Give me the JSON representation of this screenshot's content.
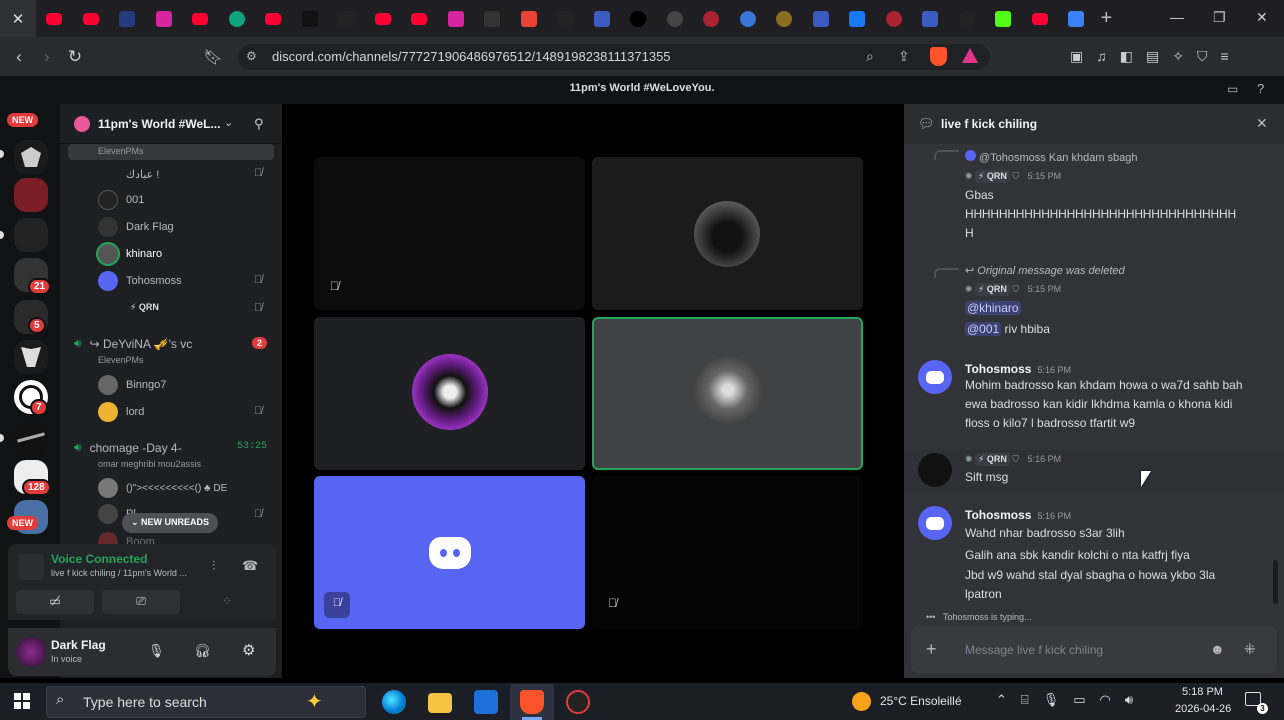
{
  "browser": {
    "tabs": [
      "youtube",
      "youtube",
      "paypal",
      "instagram",
      "youtube",
      "chatgpt",
      "youtube",
      "wattpad",
      "play",
      "youtube",
      "youtube",
      "instagram",
      "chrome-app",
      "gmail",
      "genius",
      "app",
      "x",
      "help",
      "shield",
      "globe",
      "bitcoin",
      "app",
      "facebook",
      "shield",
      "app",
      "openai",
      "kick",
      "youtube",
      "vpn"
    ],
    "url": "discord.com/channels/777271906486976512/1489198238111371355",
    "new_tab_icon": "plus"
  },
  "discord": {
    "server_title": "11pm's World #WeLoveYou.",
    "server_name": "11pm's World #WeL...",
    "rail": {
      "new_label": "NEW",
      "badges": [
        "21",
        "5",
        "7",
        "128"
      ],
      "new_label_bottom": "NEW"
    },
    "sidebar": {
      "partial_label": "ElevenPMs",
      "members_top": [
        {
          "name": "عبادك !",
          "color": "#b5bac1"
        },
        {
          "name": "001",
          "color": "#b5bac1"
        },
        {
          "name": "Dark Flag",
          "color": "#b5bac1"
        },
        {
          "name": "khinaro",
          "color": "#ffffff"
        },
        {
          "name": "Tohosmoss",
          "color": "#b5bac1"
        }
      ],
      "qrn_tag": "QRN",
      "vc2": {
        "name": "↪ DeYviNA 🎺's vc",
        "sub": "ElevenPMs",
        "badge": "2"
      },
      "members_vc2": [
        "Binngo7",
        "lord"
      ],
      "vc3": {
        "name": "chomage -Day 4-",
        "sub": "omar meghribi mou2assis",
        "timer": "53:25"
      },
      "members_vc3": [
        "()\"><<<<<<<<<() ♣ DE",
        "Pl..."
      ],
      "new_unreads": "NEW UNREADS",
      "partial_member": "Boom"
    },
    "voice": {
      "status": "Voice Connected",
      "channel": "live f kick chiling / 11pm's World ..."
    },
    "user": {
      "name": "Dark Flag",
      "status": "In voice"
    },
    "thread": {
      "title": "live f kick chiling",
      "messages": [
        {
          "reply": "@Tohosmoss Kan khdam sbagh",
          "tag": "QRN",
          "time": "5:15 PM",
          "lines": [
            "Gbas",
            "HHHHHHHHHHHHHHHHHHHHHHHHHHHHHHHH",
            "H"
          ]
        },
        {
          "reply": "Original message was deleted",
          "tag": "QRN",
          "time": "5:15 PM",
          "mention1": "@khinaro",
          "mention2": "@001",
          "text2": " riv hbiba"
        },
        {
          "author": "Tohosmoss",
          "time": "5:16 PM",
          "text": "Mohim badrosso kan khdam howa o wa7d sahb bah ewa badrosso kan kidir lkhdma kamla o khona kidi floss o kilo7 l badrosso tfartit w9"
        },
        {
          "tag": "QRN",
          "time": "5:16 PM",
          "text": "Sift msg"
        },
        {
          "author": "Tohosmoss",
          "time": "5:16 PM",
          "lines": [
            "Wahd nhar badrosso s3ar 3lih",
            "Galih ana sbk kandir kolchi o nta katfrj fiya",
            "Jbd w9 wahd stal dyal sbagha o howa ykbo 3la lpatron"
          ]
        }
      ],
      "typing": "Tohosmoss is typing...",
      "placeholder": "Message live f kick chiling"
    }
  },
  "taskbar": {
    "search_placeholder": "Type here to search",
    "weather": "25°C Ensoleillé",
    "time": "5:18 PM",
    "date": "2026-04-26",
    "notif_count": "3"
  }
}
